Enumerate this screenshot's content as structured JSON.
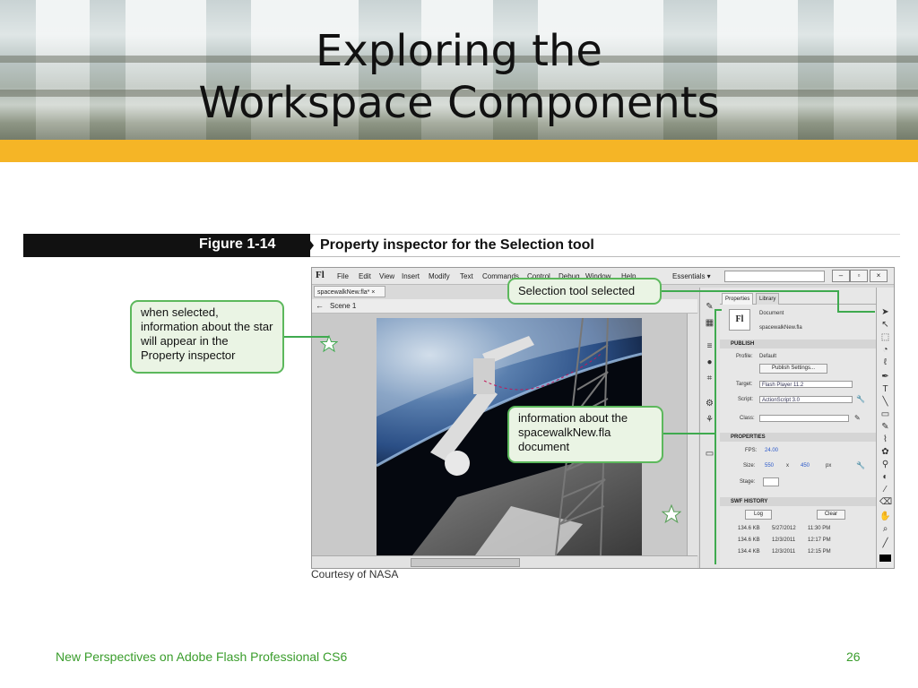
{
  "slide": {
    "title_line1": "Exploring the",
    "title_line2": "Workspace Components",
    "accent_color": "#f5b526",
    "footer_text": "New Perspectives on Adobe Flash Professional CS6",
    "footer_color": "#3a9d2c",
    "page_number": "26"
  },
  "figure": {
    "label": "Figure 1-14",
    "caption": "Property inspector for the Selection tool",
    "credit": "Courtesy of NASA"
  },
  "callouts": {
    "star_info": "when selected, information about the star will appear in the Property inspector",
    "selection_tool": "Selection tool selected",
    "doc_info": "information about the spacewalkNew.fla document",
    "border_color": "#5cb85c"
  },
  "app": {
    "logo": "Fl",
    "menus": [
      "File",
      "Edit",
      "View",
      "Insert",
      "Modify",
      "Text",
      "Commands",
      "Control",
      "Debug",
      "Window",
      "Help"
    ],
    "workspace": "Essentials ▾",
    "doc_tab": "spacewalkNew.fla* ×",
    "scene": "Scene 1",
    "panel": {
      "tab_properties": "Properties",
      "tab_library": "Library",
      "doc_type": "Document",
      "doc_name": "spacewalkNew.fla",
      "publish_header": "PUBLISH",
      "profile_label": "Profile:",
      "profile_value": "Default",
      "publish_settings": "Publish Settings...",
      "target_label": "Target:",
      "target_value": "Flash Player 11.2",
      "script_label": "Script:",
      "script_value": "ActionScript 3.0",
      "class_label": "Class:",
      "properties_header": "PROPERTIES",
      "fps_label": "FPS:",
      "fps_value": "24.00",
      "size_label": "Size:",
      "size_w": "550",
      "size_x": "x",
      "size_h": "450",
      "size_unit": "px",
      "stage_label": "Stage:",
      "history_header": "SWF HISTORY",
      "log_button": "Log",
      "clear_button": "Clear",
      "history": [
        {
          "size": "134.6 KB",
          "date": "5/27/2012",
          "time": "11:30 PM"
        },
        {
          "size": "134.6 KB",
          "date": "12/3/2011",
          "time": "12:17 PM"
        },
        {
          "size": "134.4 KB",
          "date": "12/3/2011",
          "time": "12:15 PM"
        }
      ]
    }
  }
}
